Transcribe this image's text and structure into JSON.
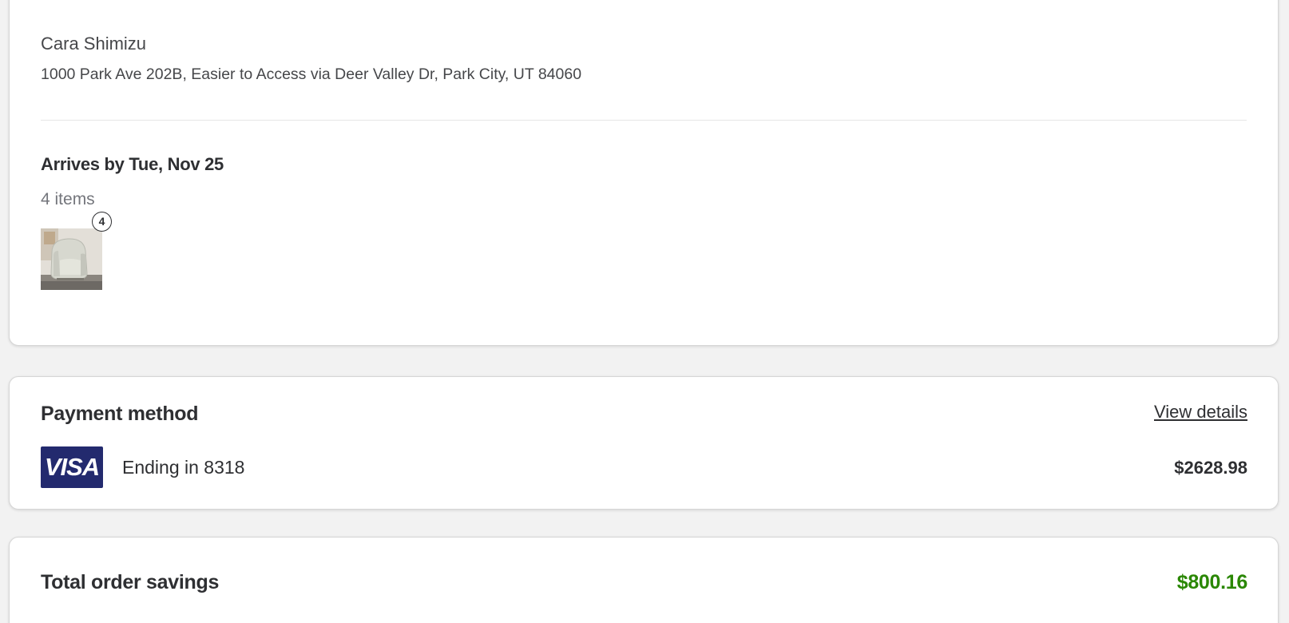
{
  "shipping": {
    "recipient_name": "Cara Shimizu",
    "address": "1000 Park Ave 202B, Easier to Access via Deer Valley Dr, Park City, UT 84060",
    "arrival": "Arrives by Tue, Nov 25",
    "item_count": "4 items",
    "quantity_badge": "4",
    "item_image": "swivel-armchair-photo"
  },
  "payment": {
    "title": "Payment method",
    "view_details": "View details",
    "card_brand": "VISA",
    "card_ending": "Ending in 8318",
    "amount": "$2628.98"
  },
  "savings": {
    "title": "Total order savings",
    "amount": "$800.16"
  },
  "colors": {
    "savings_green": "#2a8703",
    "visa_navy": "#232a6e",
    "text_dark": "#2e2f32",
    "text_muted": "#74767c"
  }
}
